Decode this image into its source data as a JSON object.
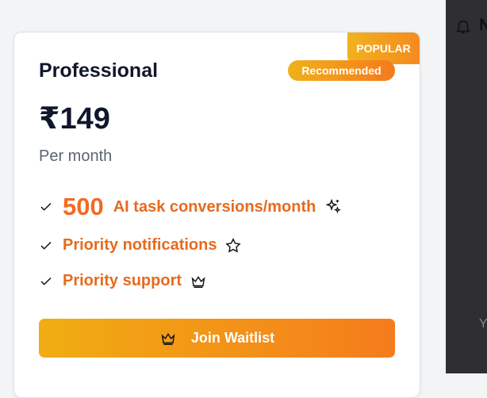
{
  "card": {
    "badge_popular": "POPULAR",
    "title": "Professional",
    "badge_recommended": "Recommended",
    "price": "₹149",
    "period": "Per month",
    "features": [
      {
        "number": "500",
        "text": "AI task conversions/month",
        "icon": "sparkles-icon"
      },
      {
        "text": "Priority notifications",
        "icon": "star-icon"
      },
      {
        "text": "Priority support",
        "icon": "crown-icon"
      }
    ],
    "button": {
      "label": "Join Waitlist",
      "icon": "crown-icon"
    }
  },
  "side_panel": {
    "partial_text_top": "N",
    "partial_text_bottom": "Y"
  },
  "colors": {
    "accent_orange": "#f48a1e",
    "accent_yellow": "#f2b21e",
    "text_dark": "#0f172a",
    "muted": "#5b6473",
    "panel_dark": "#2f2f31"
  }
}
